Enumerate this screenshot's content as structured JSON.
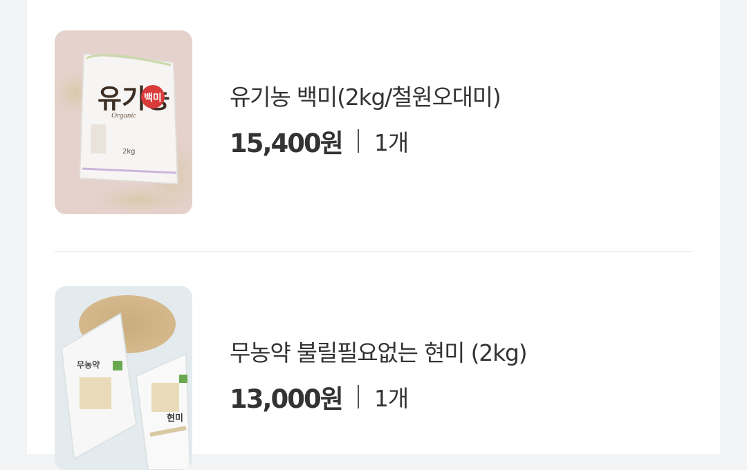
{
  "cart": {
    "items": [
      {
        "name": "유기농 백미(2kg/철원오대미)",
        "price": "15,400원",
        "quantity": "1개",
        "image": {
          "brand_text": "유기농",
          "sub_text": "Organic",
          "badge_text": "백미",
          "weight_text": "2kg"
        }
      },
      {
        "name": "무농약 불릴필요없는 현미 (2kg)",
        "price": "13,000원",
        "quantity": "1개",
        "image": {
          "brand_text": "무농약",
          "badge_text": "현미"
        }
      }
    ]
  },
  "colors": {
    "background": "#f2f3f5",
    "panel": "#ffffff",
    "text": "#333333",
    "divider": "#eeeeee"
  }
}
